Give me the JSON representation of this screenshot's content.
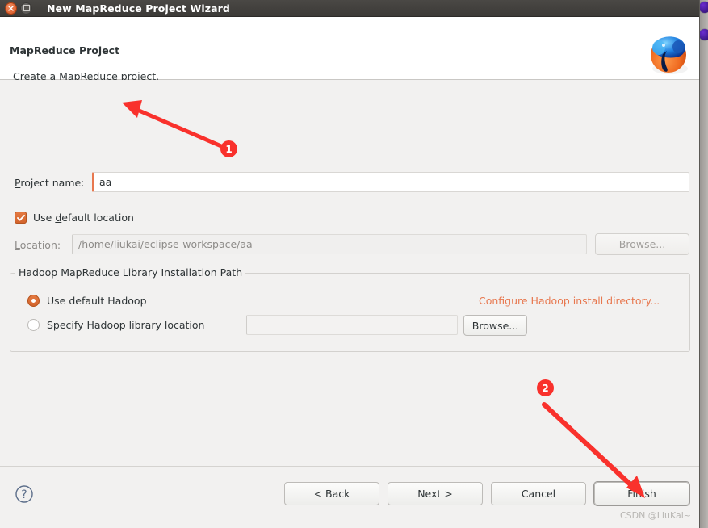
{
  "window": {
    "title": "New MapReduce Project Wizard",
    "close_icon": "close-icon",
    "maximize_icon": "maximize-icon"
  },
  "header": {
    "title": "MapReduce Project",
    "subtitle": "Create a MapReduce project.",
    "logo_icon": "hadoop-elephant-logo"
  },
  "form": {
    "project_name_label": "Project name:",
    "project_name_value": "aa",
    "project_name_placeholder": "",
    "use_default_location_label": "Use default location",
    "use_default_location_checked": true,
    "location_label": "Location:",
    "location_value": "/home/liukai/eclipse-workspace/aa",
    "browse_location_label": "Browse..."
  },
  "hadoop_group": {
    "title": "Hadoop MapReduce Library Installation Path",
    "use_default_label": "Use default Hadoop",
    "use_default_selected": true,
    "specify_label": "Specify Hadoop library location",
    "specify_selected": false,
    "library_path_value": "",
    "browse_label": "Browse...",
    "configure_link_label": "Configure Hadoop install directory...",
    "configure_link_color": "#e8784f"
  },
  "footer": {
    "help_icon": "help-icon",
    "back_label": "< Back",
    "next_label": "Next >",
    "cancel_label": "Cancel",
    "finish_label": "Finish"
  },
  "watermark": {
    "text": "CSDN @LiuKai~"
  },
  "annotations": {
    "marker_color": "#f9312c",
    "items": [
      {
        "label": "1"
      },
      {
        "label": "2"
      }
    ]
  }
}
